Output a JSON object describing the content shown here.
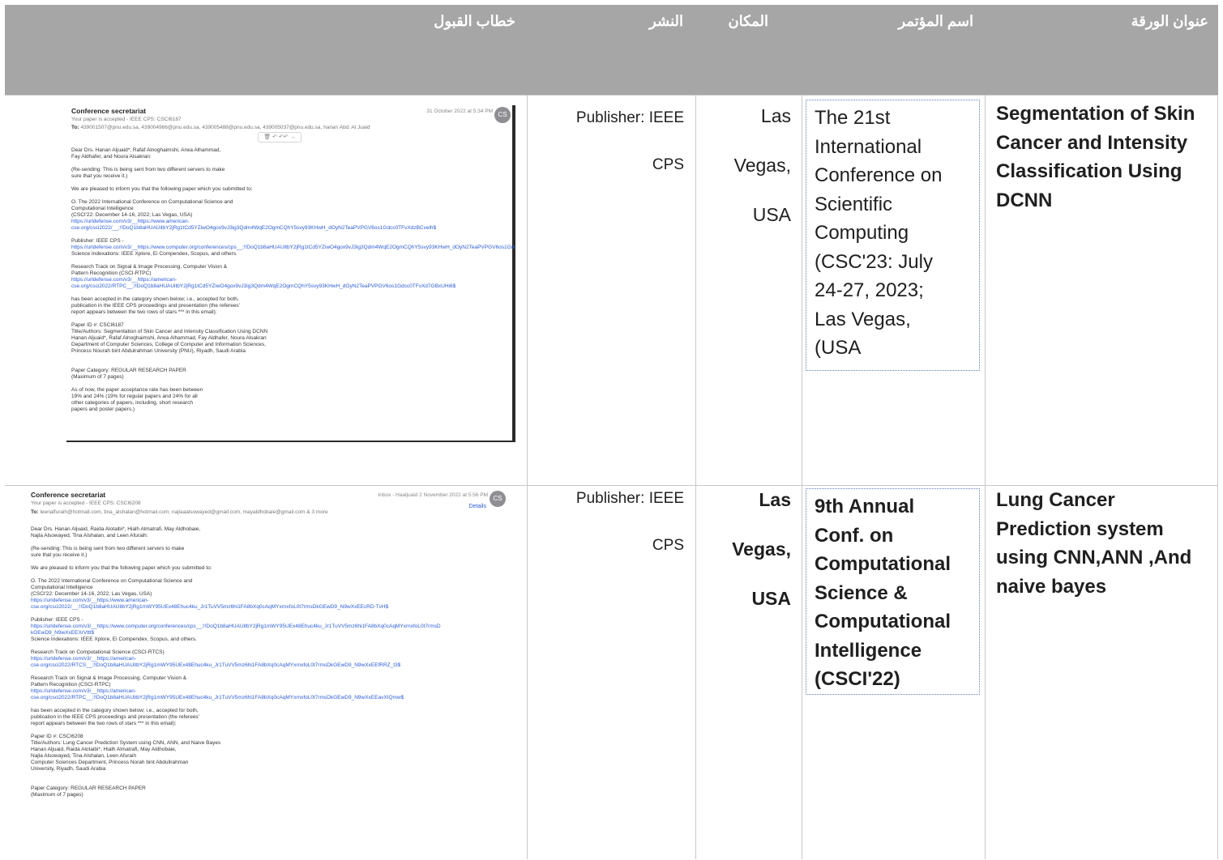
{
  "header": {
    "col_title": "عنوان الورقة",
    "col_conference": "اسم المؤتمر",
    "col_place": "المكان",
    "col_publisher": "النشر",
    "col_letter": "خطاب القبول"
  },
  "rows": [
    {
      "title": "Segmentation of Skin Cancer and Intensity Classification Using DCNN",
      "conference_lines": [
        "The 21st",
        "International",
        "Conference on",
        "Scientific",
        "Computing",
        "(CSC'23: July",
        "24-27, 2023;",
        "Las Vegas,",
        "(USA"
      ],
      "place_lines": [
        "Las",
        "Vegas,",
        "USA"
      ],
      "publisher_lines": [
        "Publisher: IEEE",
        "CPS"
      ],
      "email": {
        "sender": "Conference secretariat",
        "date": "31 October 2022 at 5:34 PM",
        "avatar": "CS",
        "subject": "Your paper is accepted - IEEE CPS: CSCI6187",
        "to_label": "To:",
        "to": "439001507@pnu.edu.sa,   439004966@pnu.edu.sa,   439005488@pnu.edu.sa,   439005037@pnu.edu.sa,   hanan Abd. Al Juaid",
        "toolbar": "🗑  ↶  ↶↶  →",
        "body": [
          {
            "t": "Dear Drs. Hanan Aljuaid*, Rafaf Alnoghaimshi, Arwa Alhammad,",
            "c": ""
          },
          {
            "t": "   Fay Aldhafer, and Noura Alsakran:",
            "c": ""
          },
          {
            "t": "",
            "c": ""
          },
          {
            "t": "   (Re-sending: This is being sent from two different servers to make",
            "c": ""
          },
          {
            "t": "    sure that you receive it.)",
            "c": ""
          },
          {
            "t": "",
            "c": ""
          },
          {
            "t": "We are pleased to inform you that the following paper which you submitted to:",
            "c": ""
          },
          {
            "t": "",
            "c": ""
          },
          {
            "t": "O.  The 2022 International Conference on Computational Science and",
            "c": ""
          },
          {
            "t": "     Computational Intelligence",
            "c": ""
          },
          {
            "t": "     (CSCI'22: December 14-16, 2022; Las Vegas, USA)",
            "c": ""
          },
          {
            "t": "     https://urldefense.com/v3/__https://www.american-",
            "c": "link"
          },
          {
            "t": "cse.org/csci2022/__;!!DoQ1b8aHUAUitbY2jRg1tCd5YZiwO4gox9vJ3ig3Qdm4WqE2OgmCQhY5svy93KHwH_dOyN2TeaPVPGV6os1Gdcc0TFvXdzBCvelh$",
            "c": "link"
          },
          {
            "t": "",
            "c": ""
          },
          {
            "t": "    Publisher: IEEE CPS -",
            "c": ""
          },
          {
            "t": "https://urldefense.com/v3/__https://www.computer.org/conferences/cps__;!!DoQ1b8aHUAUitbY2jRg1tCd5YZiwO4gox9vJ3ig3Qdm4WqE2OgmCQhY5svy93KHwH_dOyN2TeaPVPGV6os1Gdcc0TFvXd2tP3E_$",
            "c": "link"
          },
          {
            "t": "    Science Indexations: IEEE Xplore, Ei Compendex, Scopus, and others.",
            "c": ""
          },
          {
            "t": "",
            "c": ""
          },
          {
            "t": "    Research Track on Signal & Image Processing, Computer Vision &",
            "c": ""
          },
          {
            "t": "    Pattern Recognition (CSCI-RTPC)",
            "c": ""
          },
          {
            "t": "    https://urldefense.com/v3/__https://american-",
            "c": "link"
          },
          {
            "t": "cse.org/csci2022/RTPC__;!!DoQ1b8aHUAUitbY2jRg1tCd5YZiwO4gox9vJ3ig3Qdm4WqE2OgmCQhY5svy93KHwH_dOyN2TeaPVPGV6os1Gdcc0TFvXd7GBxUHi6$",
            "c": "link"
          },
          {
            "t": "",
            "c": ""
          },
          {
            "t": "has been accepted in the category shown below; i.e., accepted for both,",
            "c": ""
          },
          {
            "t": "publication in the IEEE CPS proceedings and presentation (the referees'",
            "c": ""
          },
          {
            "t": "report appears between the two rows of stars *** in this email):",
            "c": ""
          },
          {
            "t": "",
            "c": ""
          },
          {
            "t": "Paper ID #:   CSCI6187",
            "c": ""
          },
          {
            "t": "Title/Authors:  Segmentation of Skin Cancer and Intensity Classification Using DCNN",
            "c": ""
          },
          {
            "t": "          Hanan Aljuaid*, Rafaf Alnoghaimshi, Arwa Alhammad, Fay Aldhafer, Noura Alsakran",
            "c": ""
          },
          {
            "t": "          Department of Computer Sciences, College of Computer and Information Sciences,",
            "c": ""
          },
          {
            "t": "          Princess Nourah bint Abdulrahman University (PNU), Riyadh, Saudi Arabia",
            "c": ""
          },
          {
            "t": "",
            "c": ""
          },
          {
            "t": "",
            "c": ""
          },
          {
            "t": "Paper Category: REGULAR RESEARCH PAPER",
            "c": ""
          },
          {
            "t": "          (Maximum of 7 pages)",
            "c": ""
          },
          {
            "t": "",
            "c": ""
          },
          {
            "t": "          As of now, the paper acceptance rate has been between",
            "c": ""
          },
          {
            "t": "          19% and 24% (19% for regular papers and 24% for all",
            "c": ""
          },
          {
            "t": "          other categories of papers, including, short research",
            "c": ""
          },
          {
            "t": "          papers and poster papers.)",
            "c": ""
          }
        ]
      }
    },
    {
      "title": "Lung Cancer Prediction system using CNN,ANN ,And naive bayes",
      "conference_lines": [
        "9th Annual",
        "Conf. on",
        "Computational",
        "Science &",
        "Computational",
        "Intelligence",
        "(CSCI'22)"
      ],
      "place_lines": [
        "Las",
        "Vegas,",
        "USA"
      ],
      "publisher_lines": [
        "Publisher: IEEE",
        "CPS"
      ],
      "email": {
        "sender": "Conference secretariat",
        "date": "Inbox - Haaljuaid    2 November 2022 at 5:56 PM",
        "avatar": "CS",
        "subject": "Your paper is accepted - IEEE CPS: CSCI6208",
        "details": "Details",
        "to_label": "To:",
        "to": "leenalfuraih@hotmail.com,    tina_alshalan@hotmail.com,    najlaaalsowayed@gmail.com,    mayaldhobaie@gmail.com    & 3 more",
        "body": [
          {
            "t": "",
            "c": ""
          },
          {
            "t": "Dear Drs. Hanan Aljuaid, Raida Alotaibi*, Hialh Almatrafi, May Aldhobaie,",
            "c": ""
          },
          {
            "t": "   Najla Alsowayed, Tina Alshalan, and Leen Afuraih:",
            "c": ""
          },
          {
            "t": "",
            "c": ""
          },
          {
            "t": "   (Re-sending: This is being sent from two different servers to make",
            "c": ""
          },
          {
            "t": "    sure that you receive it.)",
            "c": ""
          },
          {
            "t": "",
            "c": ""
          },
          {
            "t": "We are pleased to inform you that the following paper which you submitted to:",
            "c": ""
          },
          {
            "t": "",
            "c": ""
          },
          {
            "t": "O.  The 2022 International Conference on Computational Science and",
            "c": ""
          },
          {
            "t": "     Computational Intelligence",
            "c": ""
          },
          {
            "t": "     (CSCI'22: December 14-16, 2022; Las Vegas, USA)",
            "c": ""
          },
          {
            "t": "     https://urldefense.com/v3/__https://www.american-",
            "c": "link"
          },
          {
            "t": "cse.org/csci2022/__;!!DoQ1b8aHUAUitbY2jRg1mWY95UEx48Ehuc4ku_Jr1TuVV5mz6hi1FA8bXq0cAqMYxrnxfoL0t7rmsDkGEwD9_N9wXxEEcRD-TvH$",
            "c": "link"
          },
          {
            "t": "",
            "c": ""
          },
          {
            "t": "    Publisher: IEEE CPS -",
            "c": ""
          },
          {
            "t": "https://urldefense.com/v3/__https://www.computer.org/conferences/cps__;!!DoQ1b8aHUAUitbY2jRg1mWY95UEx48Ehuc4ku_Jr1TuVV5mz6hi1FA8bXq0cAqMYxrnxfoL0t7rmsD",
            "c": "link"
          },
          {
            "t": "kGEwD9_N9wXxEEXrVttl$",
            "c": "link"
          },
          {
            "t": "    Science Indexations: IEEE Xplore, Ei Compendex, Scopus, and others.",
            "c": ""
          },
          {
            "t": "",
            "c": ""
          },
          {
            "t": "    Research Track on Computational Science (CSCI-RTCS)",
            "c": ""
          },
          {
            "t": "    https://urldefense.com/v3/__https://american-",
            "c": "link"
          },
          {
            "t": "cse.org/csci2022/RTCS__;!!DoQ1b8aHUAUitbY2jRg1mWY95UEx48Ehuc4ku_Jr1TuVV5mz6hi1FA8bXq0cAqMYxrnxfoL0t7rmsDkGEwD9_N9wXxEEfRRZ_t3$",
            "c": "link"
          },
          {
            "t": "",
            "c": ""
          },
          {
            "t": "    Research Track on Signal & Image Processing, Computer Vision &",
            "c": ""
          },
          {
            "t": "    Pattern Recognition (CSCI-RTPC)",
            "c": ""
          },
          {
            "t": "    https://urldefense.com/v3/__https://american-",
            "c": "link"
          },
          {
            "t": "cse.org/csci2022/RTPC__;!!DoQ1b8aHUAUitbY2jRg1mWY95UEx48Ehuc4ku_Jr1TuVV5mz6hi1FA8bXq0cAqMYxrnxfoL0t7rmsDkGEwD9_N9wXxEEavXIQmw$",
            "c": "link"
          },
          {
            "t": "",
            "c": ""
          },
          {
            "t": "has been accepted in the category shown below; i.e., accepted for both,",
            "c": ""
          },
          {
            "t": "publication in the IEEE CPS proceedings and presentation (the referees'",
            "c": ""
          },
          {
            "t": "report appears between the two rows of stars *** in this email):",
            "c": ""
          },
          {
            "t": "",
            "c": ""
          },
          {
            "t": "Paper ID #:   CSCI6208",
            "c": ""
          },
          {
            "t": "Title/Authors:  Lung Cancer Prediction System using CNN, ANN, and Naive Bayes",
            "c": ""
          },
          {
            "t": "          Hanan Aljuaid, Raida Alotaibi*, Hialh Almatrafi, May Aldhobaie,",
            "c": ""
          },
          {
            "t": "          Najla Alsowayed, Tina Alshalan, Leen Afuraih",
            "c": ""
          },
          {
            "t": "          Computer Sciences Department, Princess Norah bint Abdullrahman",
            "c": ""
          },
          {
            "t": "          University, Riyadh, Saudi Arabia",
            "c": ""
          },
          {
            "t": "",
            "c": ""
          },
          {
            "t": "",
            "c": ""
          },
          {
            "t": "Paper Category: REGULAR RESEARCH PAPER",
            "c": ""
          },
          {
            "t": "          (Maximum of 7 pages)",
            "c": ""
          }
        ]
      }
    }
  ],
  "colors": {
    "header_bg": "#a6a6a6",
    "header_text": "#ffffff",
    "grid": "#c8c8c8",
    "link": "#2a5cdb"
  }
}
